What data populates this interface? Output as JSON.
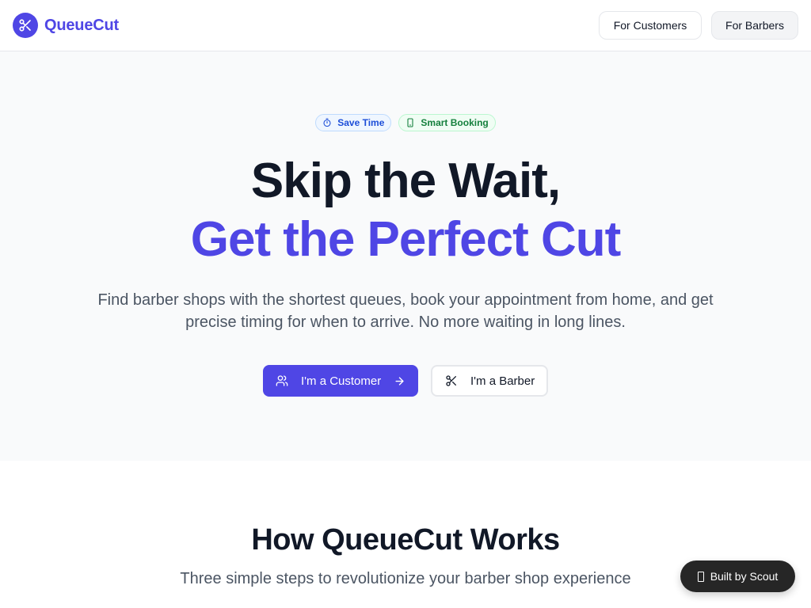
{
  "brand": {
    "name": "QueueCut",
    "logo_icon": "scissors-icon",
    "accent": "#4f46e5"
  },
  "nav": {
    "customers_label": "For Customers",
    "barbers_label": "For Barbers"
  },
  "hero": {
    "badges": [
      {
        "label": "Save Time",
        "icon": "timer-icon",
        "color": "#1d4ed8"
      },
      {
        "label": "Smart Booking",
        "icon": "smartphone-icon",
        "color": "#15803d"
      }
    ],
    "title_line1": "Skip the Wait,",
    "title_line2": "Get the Perfect Cut",
    "subtitle": "Find barber shops with the shortest queues, book your appointment from home, and get precise timing for when to arrive. No more waiting in long lines.",
    "cta_customer": {
      "label": "I'm a Customer",
      "icon": "users-icon",
      "trailing_icon": "arrow-right-icon"
    },
    "cta_barber": {
      "label": "I'm a Barber",
      "icon": "scissors-icon"
    }
  },
  "how": {
    "title": "How QueueCut Works",
    "subtitle": "Three simple steps to revolutionize your barber shop experience"
  },
  "built_badge": {
    "label": "Built by Scout",
    "icon": "device-icon"
  }
}
